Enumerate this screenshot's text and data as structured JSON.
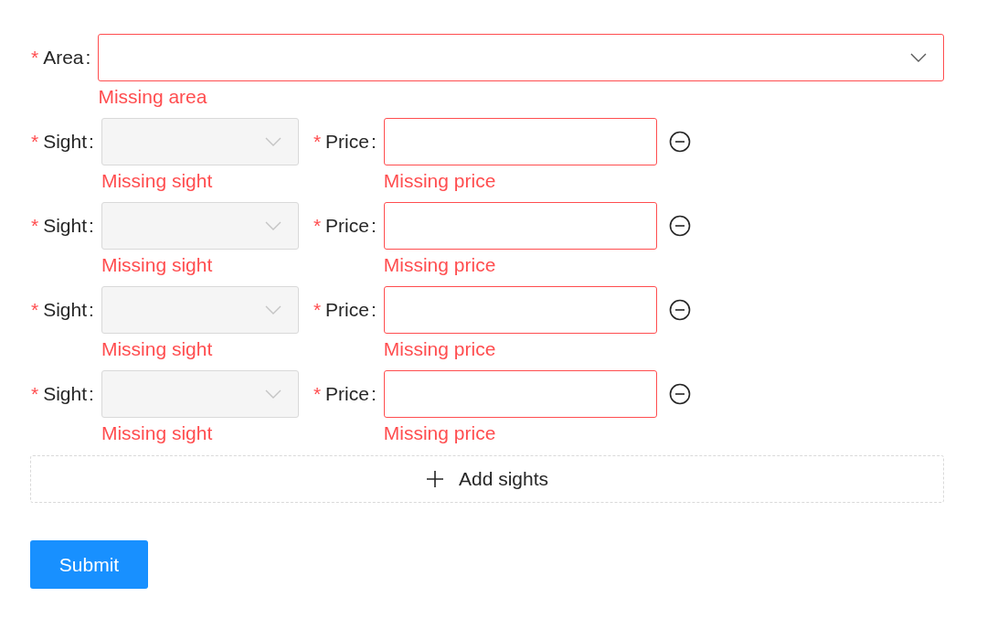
{
  "area": {
    "required_mark": "*",
    "label": "Area",
    "colon": ":",
    "error": true,
    "error_text": "Missing area"
  },
  "sights": [
    {
      "sight": {
        "required_mark": "*",
        "label": "Sight",
        "colon": ":",
        "disabled": true,
        "error_text": "Missing sight"
      },
      "price": {
        "required_mark": "*",
        "label": "Price",
        "colon": ":",
        "error": true,
        "error_text": "Missing price"
      }
    },
    {
      "sight": {
        "required_mark": "*",
        "label": "Sight",
        "colon": ":",
        "disabled": true,
        "error_text": "Missing sight"
      },
      "price": {
        "required_mark": "*",
        "label": "Price",
        "colon": ":",
        "error": true,
        "error_text": "Missing price"
      }
    },
    {
      "sight": {
        "required_mark": "*",
        "label": "Sight",
        "colon": ":",
        "disabled": true,
        "error_text": "Missing sight"
      },
      "price": {
        "required_mark": "*",
        "label": "Price",
        "colon": ":",
        "error": true,
        "error_text": "Missing price"
      }
    },
    {
      "sight": {
        "required_mark": "*",
        "label": "Sight",
        "colon": ":",
        "disabled": true,
        "error_text": "Missing sight"
      },
      "price": {
        "required_mark": "*",
        "label": "Price",
        "colon": ":",
        "error": true,
        "error_text": "Missing price"
      }
    }
  ],
  "add_button": {
    "label": "Add sights"
  },
  "submit_button": {
    "label": "Submit"
  }
}
